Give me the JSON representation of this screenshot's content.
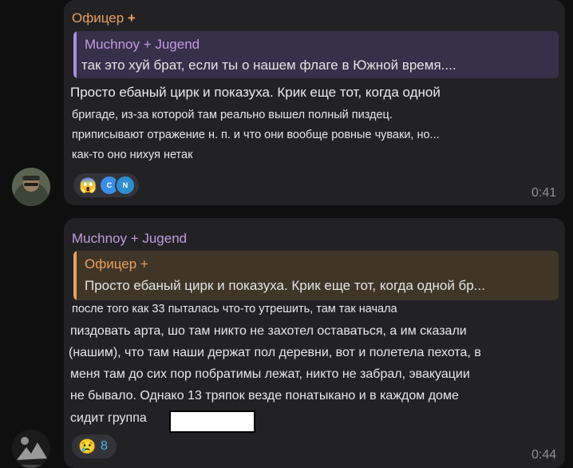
{
  "messages": [
    {
      "sender": "Офицер",
      "sender_badge": "+",
      "reply": {
        "author": "Muchnoy + Jugend",
        "text": "так это хуй брат, если ты о нашем флаге в Южной время...."
      },
      "lines": [
        "Просто ебаный цирк и показуха. Крик еще тот, когда одной",
        "бригаде, из-за которой там реально вышел полный пиздец.",
        "приписывают отражение н. п. и что они вообще ровные чуваки, но...",
        "как-то оно нихуя нетак"
      ],
      "reaction": {
        "emoji": "😱",
        "chips": [
          "C",
          "N"
        ]
      },
      "time": "0:41"
    },
    {
      "sender": "Muchnoy + Jugend",
      "reply": {
        "author": "Офицер +",
        "text": "Просто ебаный цирк и показуха. Крик еще тот, когда одной бр..."
      },
      "lines": [
        "после того как 33 пыталась что-то утрешить, там так начала",
        "пиздовать арта, шо там никто не захотел оставаться, а им сказали",
        "(нашим), что там наши держат пол деревни, вот и полетела пехота, в",
        "меня там до сих пор побратимы лежат, никто не забрал, эвакуации",
        "не бывало. Однако 13 тряпок везде понатыкано и в каждом доме",
        "сидит группа"
      ],
      "reaction": {
        "emoji": "😢",
        "count": "8"
      },
      "time": "0:44"
    }
  ],
  "colors": {
    "background": "#0f0f0f",
    "bubble": "#222225",
    "officer_name": "#e9a15e",
    "muchnoy_name": "#c49ae0",
    "reply_purple_bg": "#37304a",
    "reply_orange_bg": "#403628",
    "text": "#e8e8e8",
    "time": "#8e9196"
  },
  "icons": [
    "officer-badge-icon",
    "scream-emoji-icon",
    "cry-emoji-icon",
    "avatar-soldier",
    "avatar-dark"
  ]
}
